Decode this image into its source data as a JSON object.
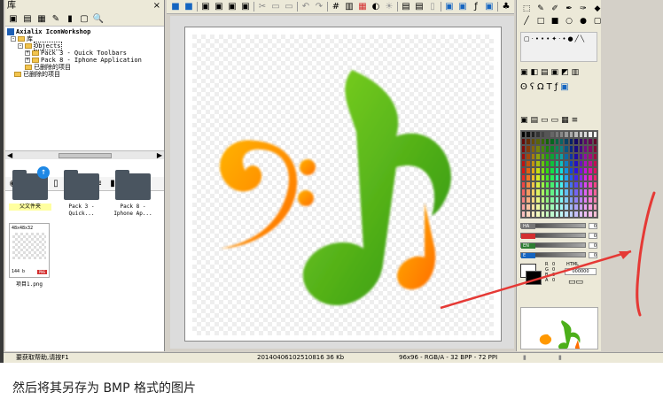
{
  "left_panel": {
    "title": "库",
    "close": "×",
    "tree": [
      {
        "label": "Axialix IconWorkshop",
        "depth": 0
      },
      {
        "label": "库",
        "depth": 1
      },
      {
        "label": "Objects",
        "depth": 2
      },
      {
        "label": "Pack 3 - Quick Toolbars",
        "depth": 3
      },
      {
        "label": "Pack 8 - Iphone Application",
        "depth": 3
      },
      {
        "label": "已删除的项目",
        "depth": 2
      },
      {
        "label": "已删除的项目",
        "depth": 1
      }
    ],
    "files": [
      {
        "label": "父文件夹"
      },
      {
        "label": "Pack 3 - Quick..."
      },
      {
        "label": "Pack 8 - Iphone Ap..."
      }
    ],
    "png": {
      "dims": "48x48x32",
      "size": "144 b",
      "badge": "PNG",
      "name": "项目1.png"
    }
  },
  "status": {
    "help": "要获取帮助,请按F1",
    "file": "20140406102510816 36 Kb",
    "format": "96x96 - RGB/A - 32 BPP - 72 PPI"
  },
  "color_panel": {
    "sliders": [
      {
        "label": "HA",
        "value": "0"
      },
      {
        "label": "",
        "value": "0"
      },
      {
        "label": "EN",
        "value": "0"
      },
      {
        "label": "E",
        "value": "0"
      }
    ],
    "html_label": "HTML",
    "html_value": "000000",
    "rgb_labels": [
      "R",
      "G",
      "B",
      "A"
    ],
    "rgb_values": [
      "0",
      "0",
      "0",
      "0"
    ]
  },
  "caption": "然后将其另存为 BMP 格式的图片",
  "colors": {
    "green": "#4caf1a",
    "orange": "#ff8f00",
    "arrow_red": "#e53935"
  }
}
